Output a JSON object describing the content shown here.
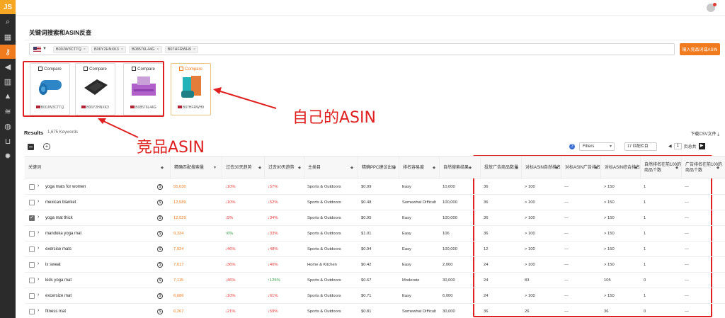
{
  "app": {
    "logo": "JS"
  },
  "sidebar": {
    "icons": [
      "search-icon",
      "store-icon",
      "key-icon",
      "megaphone-icon",
      "bar-chart-icon",
      "cap-icon",
      "layers-icon",
      "globe-icon",
      "cart-icon",
      "gear-icon"
    ]
  },
  "panel": {
    "title": "关键词搜索和ASIN反查"
  },
  "search": {
    "marketplace": "US",
    "chips": [
      "B00JW3CTTQ",
      "B06Y2HNXK3",
      "B08576L44G",
      "B07HFRWH9"
    ],
    "import_button": "输入竞品词或ASIN"
  },
  "asin_cards": [
    {
      "compare_label": "Compare",
      "asin": "B00JW3CTTQ",
      "own": false
    },
    {
      "compare_label": "Compare",
      "asin": "B06Y2HNXK3",
      "own": false
    },
    {
      "compare_label": "Compare",
      "asin": "B08576L44G",
      "own": false
    },
    {
      "compare_label": "Compare",
      "asin": "B07HFRWH9",
      "own": true
    }
  ],
  "annotations": {
    "competitor": "竞品ASIN",
    "own": "自己的ASIN"
  },
  "results": {
    "label": "Results",
    "count": "1,675 Keywords",
    "csv": "下载CSV文件"
  },
  "toolbar": {
    "help": "?",
    "filters": "Filters",
    "columns": "17 匹配栏目",
    "page": "1",
    "page_of": "页总共"
  },
  "table": {
    "headers": [
      "关键词",
      "精确匹配搜索量",
      "过去30天趋势",
      "过去90天趋势",
      "主类目",
      "精确PPC建议出价",
      "排名容易度",
      "自然搜索结果",
      "投放广告商品数量",
      "对标ASIN自然排名",
      "对标ASIN广告排名",
      "对标ASIN综合排名",
      "自然排名在前100的商品个数",
      "广告排名在前100的商品个数"
    ],
    "rows": [
      {
        "keyword": "yoga mats for women",
        "volume": "55,030",
        "t30": "10%",
        "t30_dir": "down",
        "t90": "57%",
        "t90_dir": "down",
        "category": "Sports & Outdoors",
        "ppc": "$0.99",
        "ease": "Easy",
        "results": "10,000",
        "ads": "36",
        "organic": "> 100",
        "ad_rank": "---",
        "overall": "> 150",
        "top100_org": "1",
        "top100_ad": "---",
        "checked": false
      },
      {
        "keyword": "mexican blanket",
        "volume": "12,589",
        "t30": "10%",
        "t30_dir": "down",
        "t90": "52%",
        "t90_dir": "down",
        "category": "Sports & Outdoors",
        "ppc": "$0.48",
        "ease": "Somewhat Difficult",
        "results": "100,000",
        "ads": "36",
        "organic": "> 100",
        "ad_rank": "---",
        "overall": "> 150",
        "top100_org": "1",
        "top100_ad": "---",
        "checked": false
      },
      {
        "keyword": "yoga mat thick",
        "volume": "12,029",
        "t30": "5%",
        "t30_dir": "down",
        "t90": "34%",
        "t90_dir": "down",
        "category": "Sports & Outdoors",
        "ppc": "$0.95",
        "ease": "Easy",
        "results": "100,000",
        "ads": "36",
        "organic": "> 100",
        "ad_rank": "---",
        "overall": "> 150",
        "top100_org": "1",
        "top100_ad": "---",
        "checked": true
      },
      {
        "keyword": "manduka yoga mat",
        "volume": "9,334",
        "t30": "6%",
        "t30_dir": "up",
        "t90": "33%",
        "t90_dir": "down",
        "category": "Sports & Outdoors",
        "ppc": "$1.01",
        "ease": "Easy",
        "results": "106",
        "ads": "36",
        "organic": "> 100",
        "ad_rank": "---",
        "overall": "> 150",
        "top100_org": "1",
        "top100_ad": "---",
        "checked": false
      },
      {
        "keyword": "exercise mats",
        "volume": "7,924",
        "t30": "46%",
        "t30_dir": "down",
        "t90": "48%",
        "t90_dir": "down",
        "category": "Sports & Outdoors",
        "ppc": "$0.94",
        "ease": "Easy",
        "results": "100,000",
        "ads": "12",
        "organic": "> 100",
        "ad_rank": "---",
        "overall": "> 150",
        "top100_org": "1",
        "top100_ad": "---",
        "checked": false
      },
      {
        "keyword": "lx sweat",
        "volume": "7,617",
        "t30": "36%",
        "t30_dir": "down",
        "t90": "40%",
        "t90_dir": "down",
        "category": "Home & Kitchen",
        "ppc": "$0.42",
        "ease": "Easy",
        "results": "2,000",
        "ads": "24",
        "organic": "> 100",
        "ad_rank": "---",
        "overall": "> 150",
        "top100_org": "1",
        "top100_ad": "---",
        "checked": false
      },
      {
        "keyword": "kids yoga mat",
        "volume": "7,115",
        "t30": "46%",
        "t30_dir": "down",
        "t90": "125%",
        "t90_dir": "up",
        "category": "Sports & Outdoors",
        "ppc": "$0.67",
        "ease": "Moderate",
        "results": "30,000",
        "ads": "24",
        "organic": "83",
        "ad_rank": "---",
        "overall": "105",
        "top100_org": "0",
        "top100_ad": "---",
        "checked": false
      },
      {
        "keyword": "excersize mat",
        "volume": "6,686",
        "t30": "10%",
        "t30_dir": "down",
        "t90": "61%",
        "t90_dir": "down",
        "category": "Sports & Outdoors",
        "ppc": "$0.71",
        "ease": "Easy",
        "results": "6,000",
        "ads": "24",
        "organic": "> 100",
        "ad_rank": "---",
        "overall": "> 150",
        "top100_org": "1",
        "top100_ad": "---",
        "checked": false
      },
      {
        "keyword": "fitness mat",
        "volume": "6,267",
        "t30": "21%",
        "t30_dir": "down",
        "t90": "59%",
        "t90_dir": "down",
        "category": "Sports & Outdoors",
        "ppc": "$0.81",
        "ease": "Somewhat Difficult",
        "results": "30,000",
        "ads": "36",
        "organic": "26",
        "ad_rank": "---",
        "overall": "36",
        "top100_org": "0",
        "top100_ad": "---",
        "checked": false
      }
    ]
  },
  "colors": {
    "accent": "#f07b1e",
    "annotation": "#e02020",
    "down": "#e53935",
    "up": "#2e9e44"
  }
}
